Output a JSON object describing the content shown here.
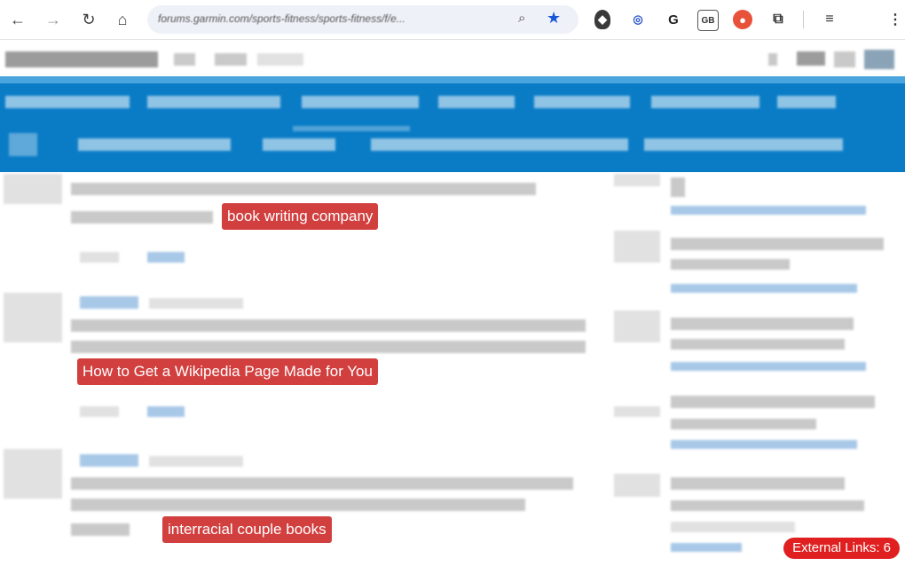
{
  "browser": {
    "url": "forums.garmin.com/sports-fitness/sports-fitness/f/e...",
    "url_suffix": "e..."
  },
  "tags": {
    "tag1": "book writing company",
    "tag2": "How to Get a Wikipedia Page Made for You",
    "tag3": "interracial couple books"
  },
  "badge": {
    "label": "External Links: 6"
  }
}
